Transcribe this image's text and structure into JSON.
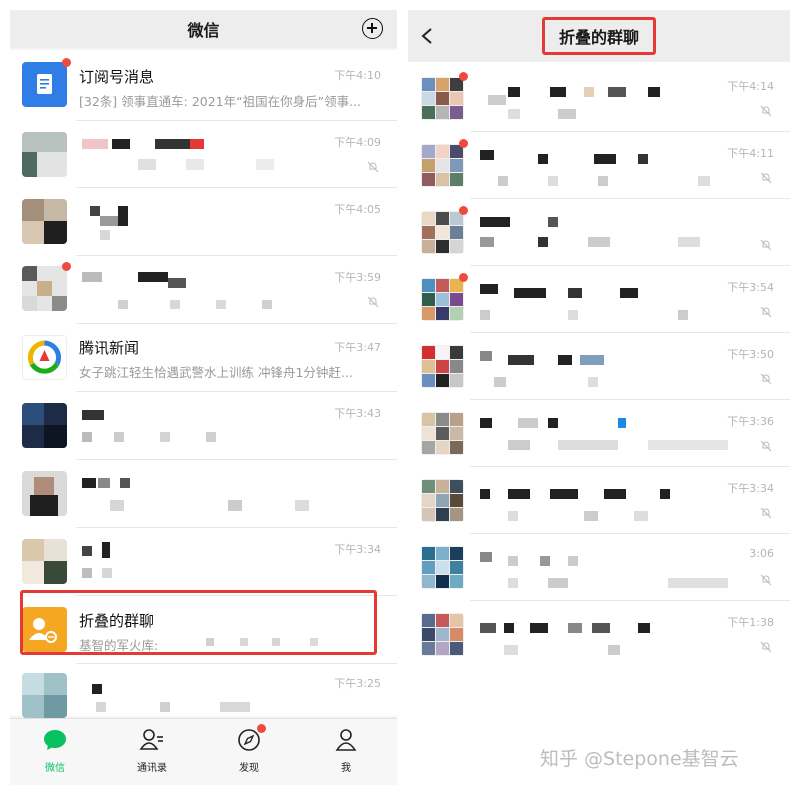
{
  "left": {
    "title": "微信",
    "rows": [
      {
        "name": "订阅号消息",
        "preview": "[32条] 领事直通车: 2021年“祖国在你身后”领事...",
        "time": "下午4:10"
      },
      {
        "name": "",
        "preview": "",
        "time": "下午4:09"
      },
      {
        "name": "",
        "preview": "",
        "time": "下午4:05"
      },
      {
        "name": "",
        "preview": "",
        "time": "下午3:59"
      },
      {
        "name": "腾讯新闻",
        "preview": "女子跳江轻生恰遇武警水上训练 冲锋舟1分钟赶...",
        "time": "下午3:47"
      },
      {
        "name": "",
        "preview": "",
        "time": "下午3:43"
      },
      {
        "name": "",
        "preview": "",
        "time": ""
      },
      {
        "name": "",
        "preview": "",
        "time": "下午3:34"
      },
      {
        "name": "折叠的群聊",
        "preview": "基智的军火库:",
        "time": ""
      },
      {
        "name": "",
        "preview": "",
        "time": "下午3:25"
      }
    ],
    "tabs": [
      {
        "label": "微信",
        "icon": "chat-bubble-icon"
      },
      {
        "label": "通讯录",
        "icon": "contacts-icon"
      },
      {
        "label": "发现",
        "icon": "compass-icon"
      },
      {
        "label": "我",
        "icon": "person-icon"
      }
    ]
  },
  "right": {
    "title": "折叠的群聊",
    "times": [
      "下午4:14",
      "下午4:11",
      "",
      "下午3:54",
      "下午3:50",
      "下午3:36",
      "下午3:34",
      "3:06",
      "下午1:38"
    ]
  },
  "watermark": "知乎 @Stepone基智云",
  "colors": {
    "accent": "#07c160",
    "badge": "#f04a3e",
    "highlight": "#e53935"
  }
}
